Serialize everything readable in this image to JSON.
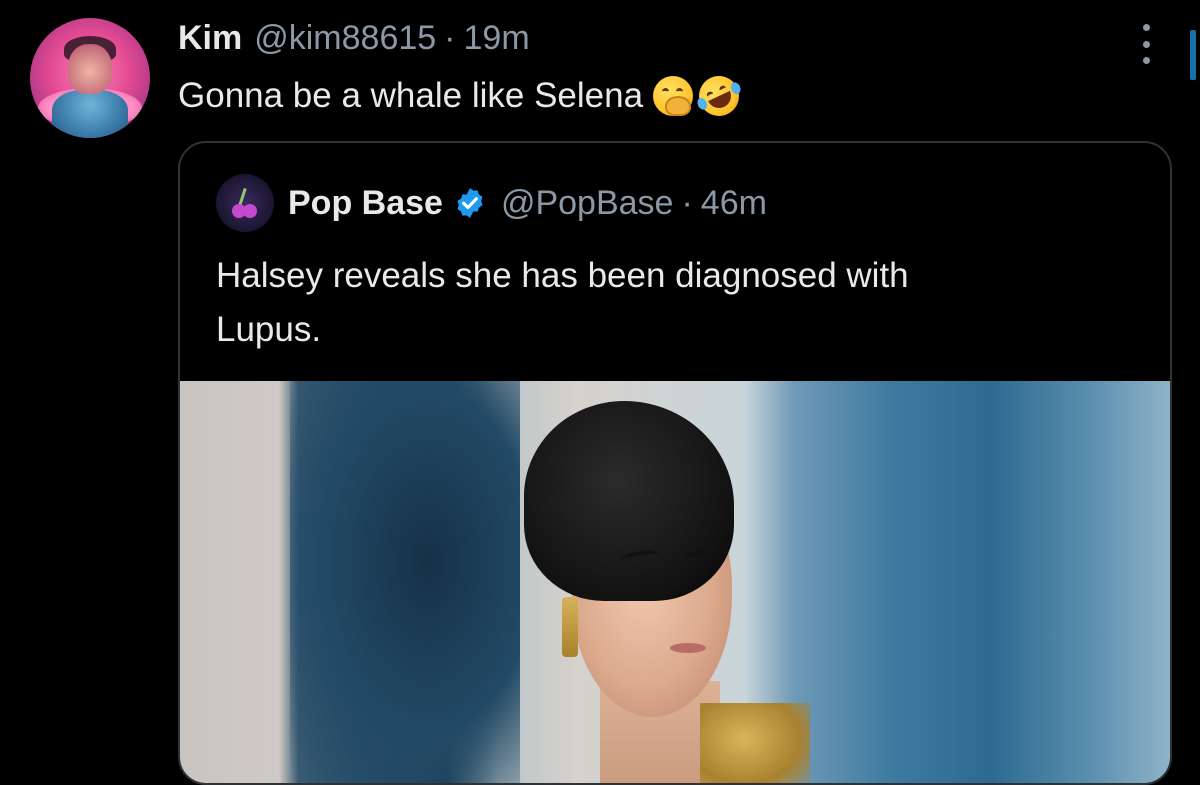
{
  "tweet": {
    "author_name": "Kim",
    "author_handle": "@kim88615",
    "separator": "·",
    "time": "19m",
    "text": "Gonna be a whale like Selena",
    "emojis": [
      "face-with-hand-over-mouth",
      "rolling-on-the-floor-laughing"
    ]
  },
  "quoted_tweet": {
    "author_name": "Pop Base",
    "verified": true,
    "author_handle": "@PopBase",
    "separator": "·",
    "time": "46m",
    "text_lines": [
      "Halsey reveals she has been diagnosed with",
      "Lupus."
    ]
  },
  "colors": {
    "background": "#000000",
    "primary_text": "#e7e9ea",
    "secondary_text": "#8b98a5",
    "card_border": "#2f3336",
    "verified_blue": "#1d9bf0"
  }
}
